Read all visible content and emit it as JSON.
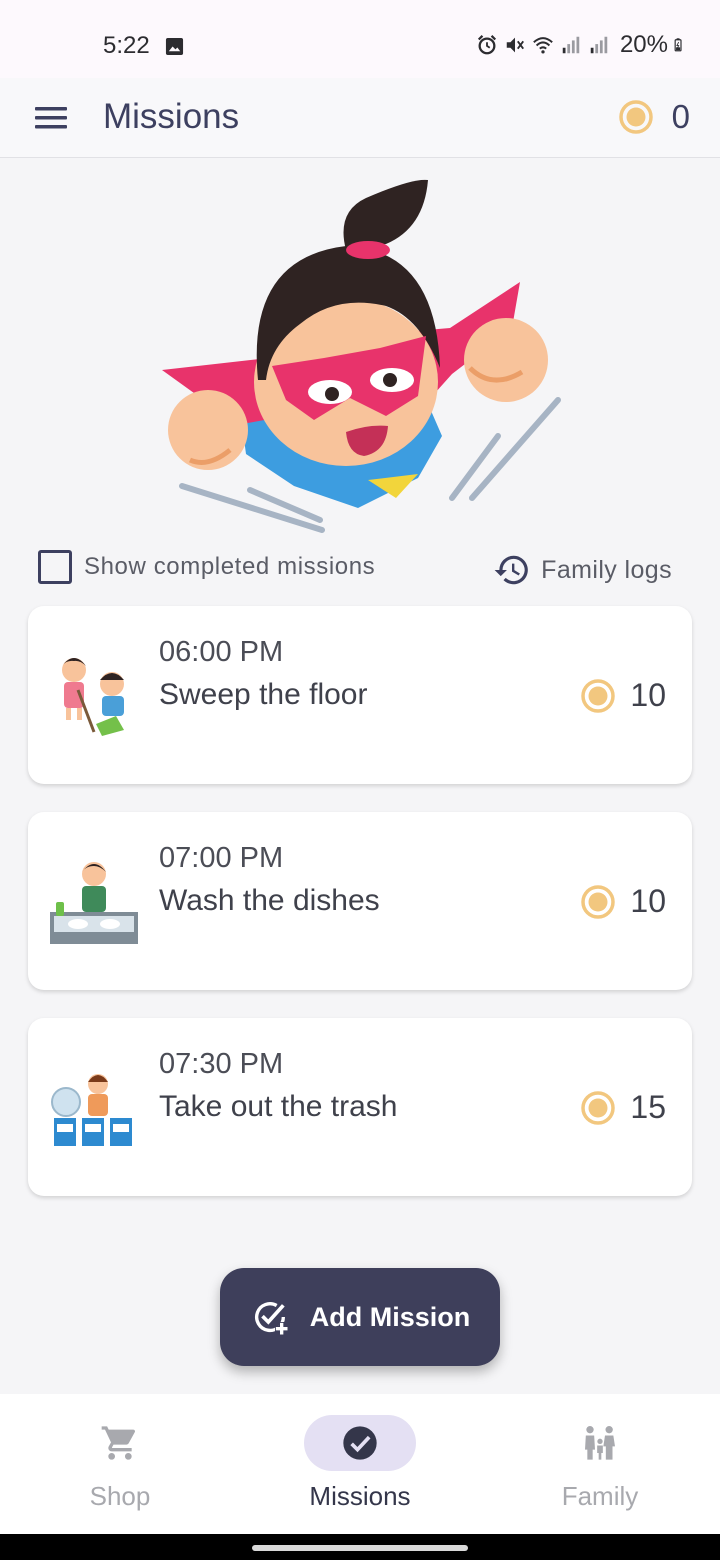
{
  "status_bar": {
    "time": "5:22",
    "battery": "20%"
  },
  "app_bar": {
    "title": "Missions",
    "coin_balance": "0"
  },
  "filters": {
    "show_completed_label": "Show completed missions",
    "show_completed_checked": false,
    "family_logs_label": "Family logs"
  },
  "missions": [
    {
      "time": "06:00 PM",
      "name": "Sweep the floor",
      "reward": "10",
      "icon": "sweeping-kids-illustration"
    },
    {
      "time": "07:00 PM",
      "name": "Wash the dishes",
      "reward": "10",
      "icon": "dishwashing-boy-illustration"
    },
    {
      "time": "07:30 PM",
      "name": "Take out the trash",
      "reward": "15",
      "icon": "trash-sorting-girl-illustration"
    }
  ],
  "fab": {
    "label": "Add Mission"
  },
  "bottom_nav": {
    "items": [
      {
        "label": "Shop",
        "icon": "cart-icon",
        "active": false
      },
      {
        "label": "Missions",
        "icon": "check-circle-icon",
        "active": true
      },
      {
        "label": "Family",
        "icon": "family-icon",
        "active": false
      }
    ]
  },
  "colors": {
    "primary": "#3e3f5b",
    "coin": "#f2c77f",
    "active_nav_bg": "#e4e0f3",
    "hero_mask": "#e8336b",
    "hero_suit": "#3d9de0"
  }
}
